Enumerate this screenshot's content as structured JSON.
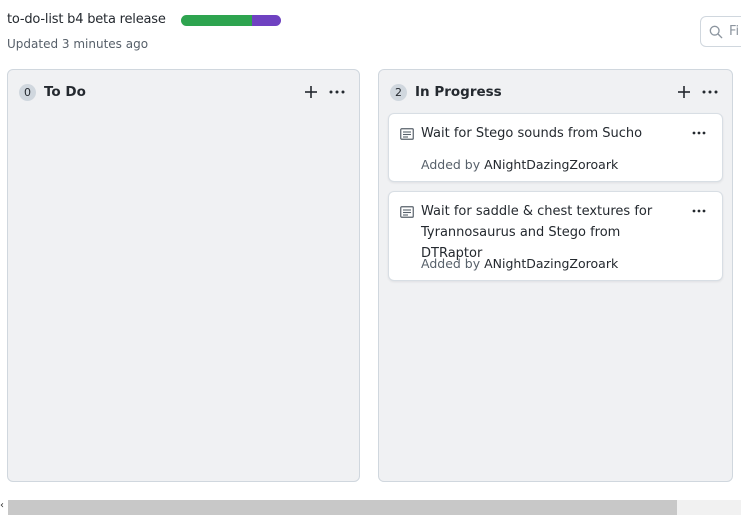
{
  "project": {
    "title": "to-do-list b4 beta release",
    "updated": "Updated 3 minutes ago",
    "progress": {
      "done_fraction": 0.71,
      "in_progress_fraction": 0.29,
      "done_color": "#2ea44f",
      "in_progress_color": "#6f42c1"
    }
  },
  "filter": {
    "placeholder": "Fi",
    "icon": "search-icon"
  },
  "columns": [
    {
      "name": "To Do",
      "count": "0",
      "cards": []
    },
    {
      "name": "In Progress",
      "count": "2",
      "cards": [
        {
          "text": "Wait for Stego sounds from Sucho",
          "added_by_label": "Added by",
          "author": "ANightDazingZoroark"
        },
        {
          "text_line1": "Wait for saddle & chest textures for",
          "text_line2": "Tyrannosaurus and Stego from DTRaptor",
          "added_by_label": "Added by",
          "author": "ANightDazingZoroark"
        }
      ]
    }
  ],
  "scrollbar": {
    "left_arrow": "‹"
  }
}
